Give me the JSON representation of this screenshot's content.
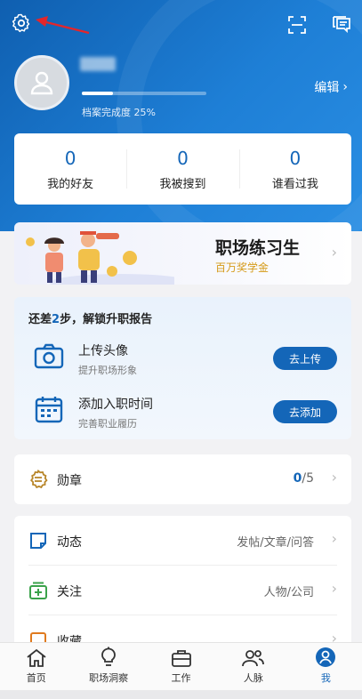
{
  "header": {
    "settings_icon": "gear-icon",
    "scan_icon": "scan-icon",
    "message_icon": "chat-icon",
    "edit_label": "编辑",
    "profile_completion_label": "档案完成度 25%",
    "profile_completion_fraction": 0.25
  },
  "stats": [
    {
      "value": "0",
      "label": "我的好友"
    },
    {
      "value": "0",
      "label": "我被搜到"
    },
    {
      "value": "0",
      "label": "谁看过我"
    }
  ],
  "banner": {
    "title": "职场练习生",
    "subtitle": "百万奖学金"
  },
  "unlock": {
    "title_prefix": "还差",
    "title_count": "2",
    "title_suffix": "步，解锁升职报告",
    "tasks": [
      {
        "title": "上传头像",
        "subtitle": "提升职场形象",
        "button": "去上传",
        "icon": "camera-icon"
      },
      {
        "title": "添加入职时间",
        "subtitle": "完善职业履历",
        "button": "去添加",
        "icon": "calendar-icon"
      }
    ]
  },
  "medal": {
    "label": "勋章",
    "earned": "0",
    "total": "/5"
  },
  "list": [
    {
      "label": "动态",
      "value": "发帖/文章/问答",
      "icon": "note-icon"
    },
    {
      "label": "关注",
      "value": "人物/公司",
      "icon": "follow-icon"
    },
    {
      "label": "收藏",
      "value": "",
      "icon": "bookmark-icon"
    }
  ],
  "tabs": [
    {
      "label": "首页",
      "icon": "home-icon"
    },
    {
      "label": "职场洞察",
      "icon": "lightbulb-icon"
    },
    {
      "label": "工作",
      "icon": "briefcase-icon"
    },
    {
      "label": "人脉",
      "icon": "contacts-icon"
    },
    {
      "label": "我",
      "icon": "profile-icon",
      "active": true
    }
  ],
  "colors": {
    "brand": "#1466b8",
    "header_bg": "#1e7fd6",
    "banner_sub": "#d59a18",
    "medal_icon": "#b8862a",
    "list_icon_green": "#3aa24a",
    "list_icon_orange": "#e07a1e"
  }
}
